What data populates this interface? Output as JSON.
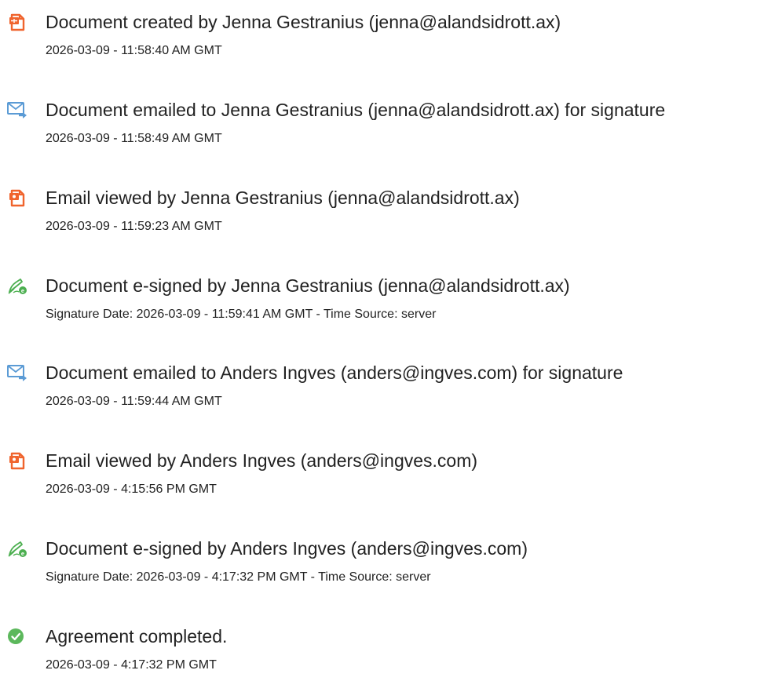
{
  "events": [
    {
      "icon": "document-created-icon",
      "title": "Document created by Jenna Gestranius (jenna@alandsidrott.ax)",
      "detail": "2026-03-09 - 11:58:40 AM GMT"
    },
    {
      "icon": "email-sent-icon",
      "title": "Document emailed to Jenna Gestranius (jenna@alandsidrott.ax) for signature",
      "detail": "2026-03-09 - 11:58:49 AM GMT"
    },
    {
      "icon": "document-viewed-icon",
      "title": "Email viewed by Jenna Gestranius (jenna@alandsidrott.ax)",
      "detail": "2026-03-09 - 11:59:23 AM GMT"
    },
    {
      "icon": "e-signed-icon",
      "title": "Document e-signed by Jenna Gestranius (jenna@alandsidrott.ax)",
      "detail": "Signature Date: 2026-03-09 - 11:59:41 AM GMT - Time Source: server"
    },
    {
      "icon": "email-sent-icon",
      "title": "Document emailed to Anders Ingves (anders@ingves.com) for signature",
      "detail": "2026-03-09 - 11:59:44 AM GMT"
    },
    {
      "icon": "document-viewed-icon",
      "title": "Email viewed by Anders Ingves (anders@ingves.com)",
      "detail": "2026-03-09 - 4:15:56 PM GMT"
    },
    {
      "icon": "e-signed-icon",
      "title": "Document e-signed by Anders Ingves (anders@ingves.com)",
      "detail": "Signature Date: 2026-03-09 - 4:17:32 PM GMT - Time Source: server"
    },
    {
      "icon": "checkmark-circle-icon",
      "title": "Agreement completed.",
      "detail": "2026-03-09 - 4:17:32 PM GMT"
    }
  ],
  "colors": {
    "document_icon": "#F0642D",
    "email_icon": "#5B9BD5",
    "esign_icon": "#4CAF50",
    "complete_icon": "#5CB85C",
    "text": "#222222"
  }
}
